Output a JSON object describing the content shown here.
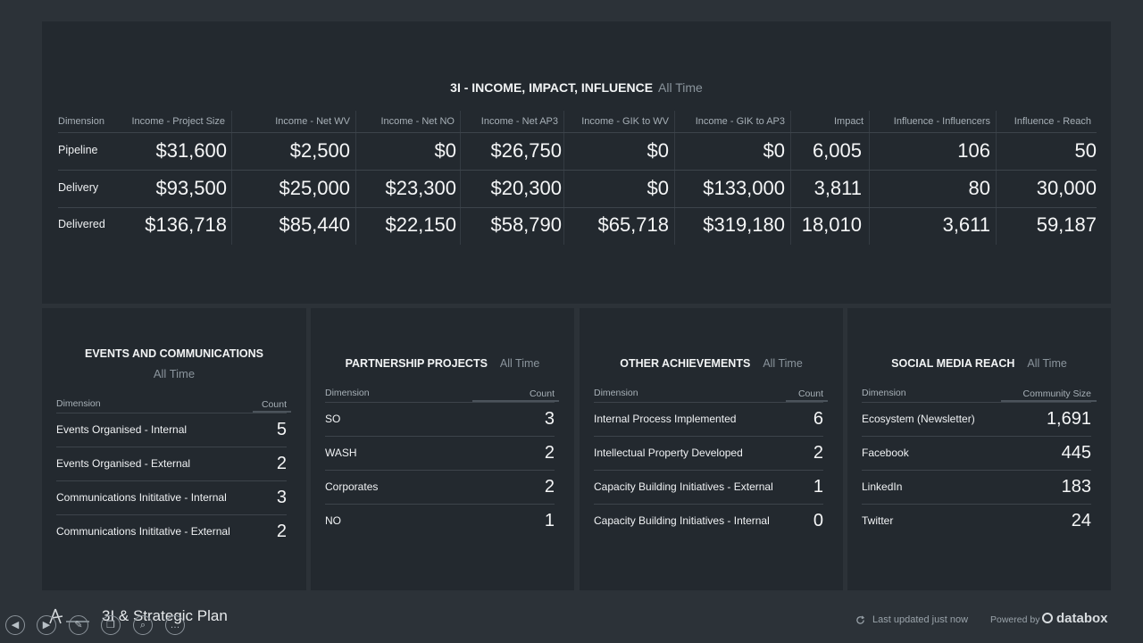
{
  "main_panel": {
    "title": "3I - INCOME, IMPACT, INFLUENCE",
    "period": "All Time",
    "columns": [
      "Dimension",
      "Income - Project Size",
      "Income - Net WV",
      "Income - Net NO",
      "Income - Net AP3",
      "Income - GIK to WV",
      "Income - GIK to AP3",
      "Impact",
      "Influence - Influencers",
      "Influence - Reach"
    ],
    "rows": [
      {
        "label": "Pipeline",
        "values": [
          "$31,600",
          "$2,500",
          "$0",
          "$26,750",
          "$0",
          "$0",
          "6,005",
          "106",
          "50"
        ]
      },
      {
        "label": "Delivery",
        "values": [
          "$93,500",
          "$25,000",
          "$23,300",
          "$20,300",
          "$0",
          "$133,000",
          "3,811",
          "80",
          "30,000"
        ]
      },
      {
        "label": "Delivered",
        "values": [
          "$136,718",
          "$85,440",
          "$22,150",
          "$58,790",
          "$65,718",
          "$319,180",
          "18,010",
          "3,611",
          "59,187"
        ]
      }
    ]
  },
  "events": {
    "title": "EVENTS AND COMMUNICATIONS",
    "period": "All Time",
    "col_dimension": "Dimension",
    "col_value": "Count",
    "rows": [
      {
        "label": "Events Organised - Internal",
        "value": "5"
      },
      {
        "label": "Events Organised - External",
        "value": "2"
      },
      {
        "label": "Communications Inititative - Internal",
        "value": "3"
      },
      {
        "label": "Communications Inititative - External",
        "value": "2"
      }
    ]
  },
  "partnership": {
    "title": "PARTNERSHIP PROJECTS",
    "period": "All Time",
    "col_dimension": "Dimension",
    "col_value": "Count",
    "rows": [
      {
        "label": "SO",
        "value": "3"
      },
      {
        "label": "WASH",
        "value": "2"
      },
      {
        "label": "Corporates",
        "value": "2"
      },
      {
        "label": "NO",
        "value": "1"
      }
    ]
  },
  "other": {
    "title": "OTHER ACHIEVEMENTS",
    "period": "All Time",
    "col_dimension": "Dimension",
    "col_value": "Count",
    "rows": [
      {
        "label": "Internal Process Implemented",
        "value": "6"
      },
      {
        "label": "Intellectual Property Developed",
        "value": "2"
      },
      {
        "label": "Capacity Building Initiatives - External",
        "value": "1"
      },
      {
        "label": "Capacity Building Initiatives - Internal",
        "value": "0"
      }
    ]
  },
  "social": {
    "title": "SOCIAL MEDIA REACH",
    "period": "All Time",
    "col_dimension": "Dimension",
    "col_value": "Community Size",
    "rows": [
      {
        "label": "Ecosystem (Newsletter)",
        "value": "1,691"
      },
      {
        "label": "Facebook",
        "value": "445"
      },
      {
        "label": "LinkedIn",
        "value": "183"
      },
      {
        "label": "Twitter",
        "value": "24"
      }
    ]
  },
  "footer": {
    "title": "3I & Strategic Plan",
    "updated": "Last updated just now",
    "powered": "Powered by",
    "brand": "databox"
  },
  "icons": {
    "back": "chevron-left-icon",
    "play": "play-icon",
    "edit": "pencil-icon",
    "copy": "copy-icon",
    "search": "magnifier-icon",
    "more": "ellipsis-icon",
    "refresh": "refresh-icon"
  },
  "colors": {
    "background": "#2c3238",
    "panel": "#23292f",
    "text": "#e6e9ec",
    "muted": "#8a949c"
  }
}
